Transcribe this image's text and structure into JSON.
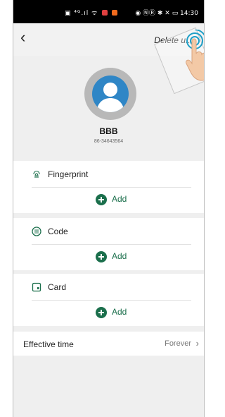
{
  "status_bar": {
    "left": "▣ ⁴ᴳ.ıl ᯤ",
    "right": "◉ ⓃⓇ ✱ ✕ ▭ 14:30"
  },
  "navbar": {
    "back_icon": "chevron-left",
    "delete_label": "Delete u..."
  },
  "profile": {
    "name": "BBB",
    "phone": "86-34643564",
    "avatar_color": "#2f86c6"
  },
  "sections": [
    {
      "title": "Fingerprint",
      "icon": "fingerprint-icon",
      "add_label": "Add"
    },
    {
      "title": "Code",
      "icon": "keypad-icon",
      "add_label": "Add"
    },
    {
      "title": "Card",
      "icon": "card-icon",
      "add_label": "Add"
    }
  ],
  "effective_time": {
    "label": "Effective time",
    "value": "Forever"
  },
  "colors": {
    "accent": "#1b6f4c",
    "background": "#efefef"
  }
}
